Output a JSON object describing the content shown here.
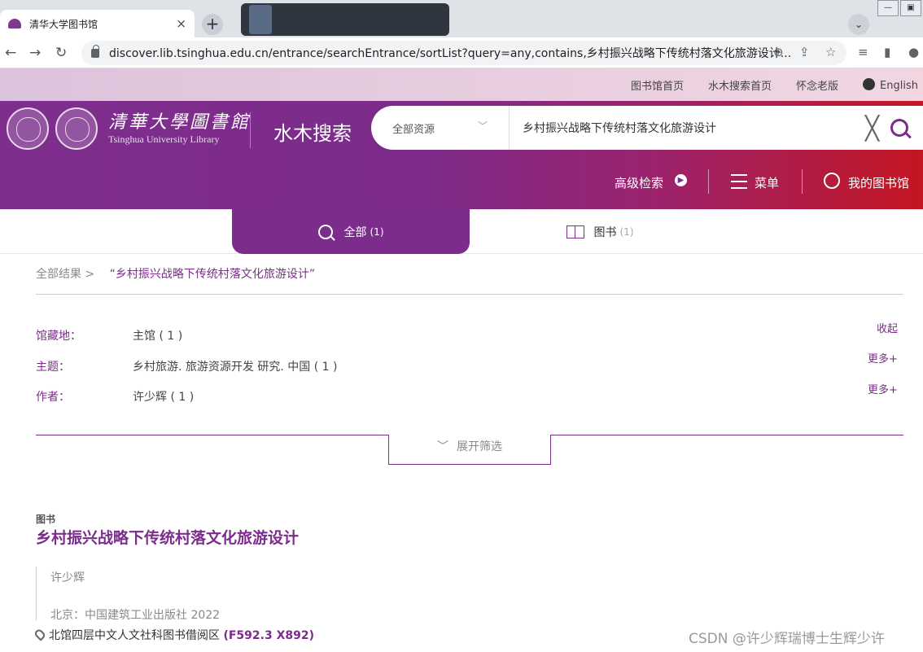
{
  "browser": {
    "tab_title": "清华大学图书馆",
    "tab_close": "×",
    "new_tab": "+",
    "tab_search": "⌄",
    "win_min": "—",
    "win_max": "▣",
    "url": "discover.lib.tsinghua.edu.cn/entrance/searchEntrance/sortList?query=any,contains,乡村振兴战略下传统村落文化旅游设计..."
  },
  "toplinks": {
    "home": "图书馆首页",
    "search_home": "水木搜索首页",
    "old_version": "怀念老版",
    "english": "English"
  },
  "header": {
    "library_name": "清華大學圖書館",
    "library_name_en": "Tsinghua University Library",
    "brand": "水木搜索",
    "scope": "全部资源",
    "query": "乡村振兴战略下传统村落文化旅游设计",
    "advanced": "高级检索",
    "menu": "菜单",
    "my_library": "我的图书馆"
  },
  "tabs": [
    {
      "label": "全部",
      "count": "(1)"
    },
    {
      "label": "图书",
      "count": "(1)"
    }
  ],
  "breadcrumb": {
    "root": "全部结果 >",
    "query": "“乡村振兴战略下传统村落文化旅游设计”"
  },
  "facets": {
    "collapse": "收起",
    "items": [
      {
        "label": "馆藏地：",
        "value": "主馆 ( 1 )",
        "action": ""
      },
      {
        "label": "主题：",
        "value": "乡村旅游. 旅游资源开发 研究. 中国 ( 1 )",
        "action": "更多+"
      },
      {
        "label": "作者：",
        "value": "许少辉 ( 1 )",
        "action": "更多+"
      }
    ],
    "expand": "展开筛选"
  },
  "result": {
    "type": "图书",
    "title": "乡村振兴战略下传统村落文化旅游设计",
    "author": "许少辉",
    "publisher": "北京：中国建筑工业出版社 2022",
    "location": "北馆四层中文人文社科图书借阅区",
    "call_number": "(F592.3 X892)"
  },
  "watermark": "CSDN @许少辉瑞博士生辉少许",
  "colors": {
    "brand": "#7c2c8b",
    "red": "#c41622"
  }
}
